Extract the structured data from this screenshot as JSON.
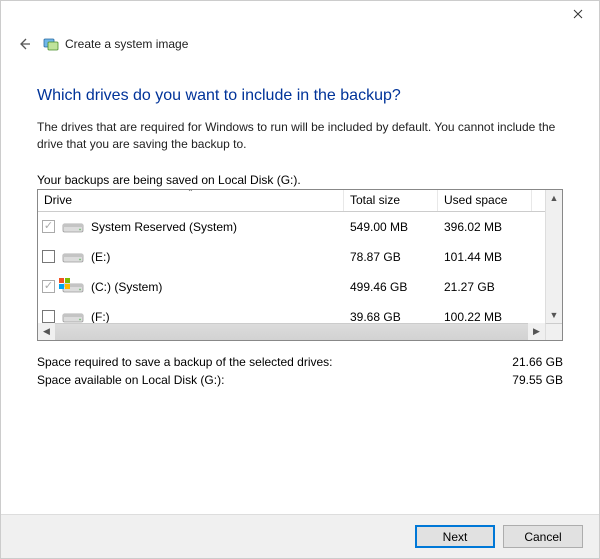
{
  "window": {
    "wizard_title": "Create a system image"
  },
  "page": {
    "heading": "Which drives do you want to include in the backup?",
    "description": "The drives that are required for Windows to run will be included by default. You cannot include the drive that you are saving the backup to.",
    "saved_on": "Your backups are being saved on Local Disk (G:)."
  },
  "grid": {
    "columns": {
      "drive": "Drive",
      "total_size": "Total size",
      "used_space": "Used space"
    },
    "rows": [
      {
        "checked": true,
        "disabled": true,
        "has_winflag": false,
        "name": "System Reserved (System)",
        "total": "549.00 MB",
        "used": "396.02 MB"
      },
      {
        "checked": false,
        "disabled": false,
        "has_winflag": false,
        "name": "(E:)",
        "total": "78.87 GB",
        "used": "101.44 MB"
      },
      {
        "checked": true,
        "disabled": true,
        "has_winflag": true,
        "name": "(C:) (System)",
        "total": "499.46 GB",
        "used": "21.27 GB"
      },
      {
        "checked": false,
        "disabled": false,
        "has_winflag": false,
        "name": "(F:)",
        "total": "39.68 GB",
        "used": "100.22 MB"
      }
    ]
  },
  "summary": {
    "required_label": "Space required to save a backup of the selected drives:",
    "required_value": "21.66 GB",
    "available_label": "Space available on Local Disk (G:):",
    "available_value": "79.55 GB"
  },
  "buttons": {
    "next": "Next",
    "cancel": "Cancel"
  }
}
